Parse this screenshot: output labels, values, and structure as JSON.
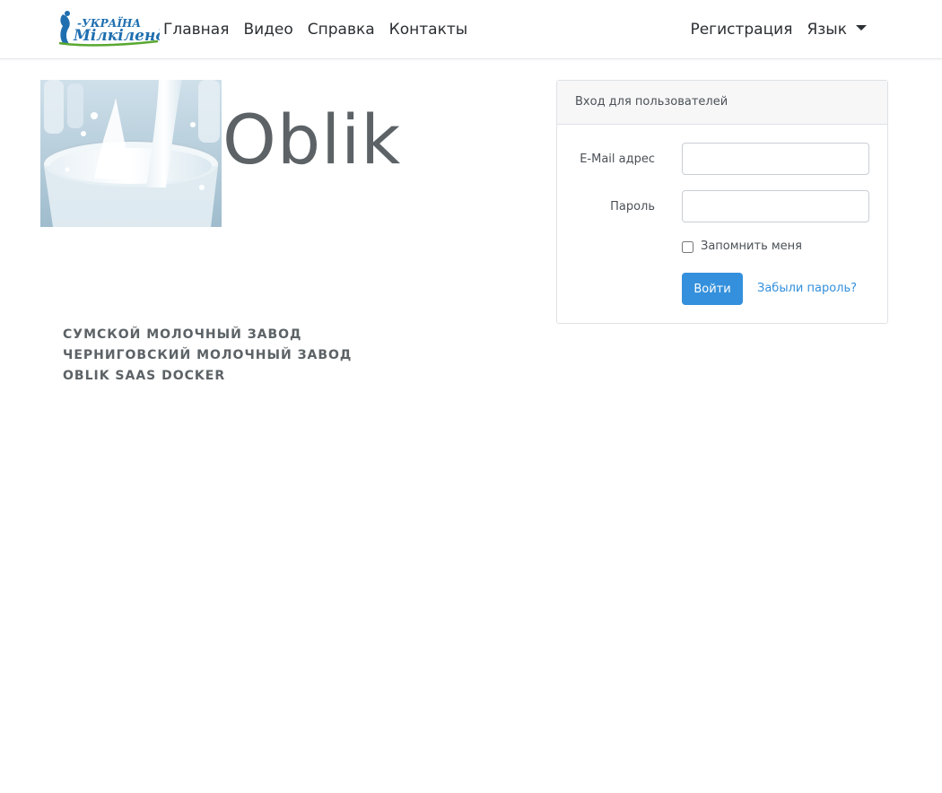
{
  "brand": {
    "logo_text_top": "-УКРАЇНА",
    "logo_text_main": "Мілкіленд"
  },
  "nav": {
    "items": [
      {
        "label": "Главная"
      },
      {
        "label": "Видео"
      },
      {
        "label": "Справка"
      },
      {
        "label": "Контакты"
      }
    ],
    "register_label": "Регистрация",
    "language_label": "Язык"
  },
  "hero": {
    "title": "Oblik",
    "image_icon": "milk-glass-image"
  },
  "plants": [
    {
      "label": "Сумской молочный завод"
    },
    {
      "label": "Черниговский молочный завод"
    },
    {
      "label": "Oblik SaaS Docker"
    }
  ],
  "login": {
    "header": "Вход для пользователей",
    "email_label": "E-Mail адрес",
    "email_value": "",
    "password_label": "Пароль",
    "password_value": "",
    "remember_label": "Запомнить меня",
    "remember_checked": false,
    "submit_label": "Войти",
    "forgot_label": "Забыли пароль?"
  },
  "colors": {
    "accent": "#3490dc",
    "text_muted": "#5c6266",
    "brand_blue": "#1f6fb0",
    "brand_green": "#5aa832"
  }
}
